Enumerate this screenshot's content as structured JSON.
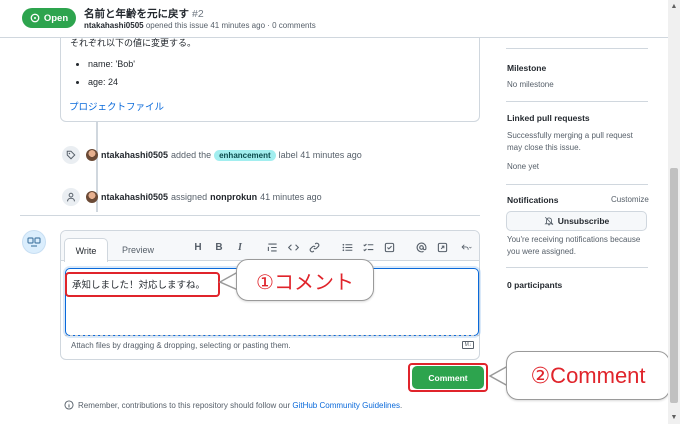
{
  "header": {
    "state": "Open",
    "title": "名前と年齢を元に戻す",
    "number": "#2",
    "author": "ntakahashi0505",
    "meta": "opened this issue 41 minutes ago · 0 comments"
  },
  "body": {
    "cut_text": "それぞれ以下の値に変更する。",
    "bullets": [
      "name: 'Bob'",
      "age: 24"
    ],
    "link": "プロジェクトファイル"
  },
  "timeline": {
    "label_event": {
      "actor": "ntakahashi0505",
      "verb": "added the",
      "label": "enhancement",
      "tail": "label 41 minutes ago"
    },
    "assign_event": {
      "actor": "ntakahashi0505",
      "verb": "assigned",
      "assignee": "nonprokun",
      "tail": "41 minutes ago"
    }
  },
  "editor": {
    "tabs": {
      "write": "Write",
      "preview": "Preview"
    },
    "toolbar": {
      "heading": "H",
      "bold": "B",
      "italic": "I",
      "icons": [
        "quote-icon",
        "code-icon",
        "link-icon",
        "unordered-list-icon",
        "task-list-icon",
        "checkbox-icon",
        "mention-icon",
        "reference-icon",
        "reply-icon"
      ]
    },
    "text": "承知しました！対応しますね。",
    "attach_hint": "Attach files by dragging & dropping, selecting or pasting them.",
    "markdown_badge": "M↓",
    "submit": "Comment"
  },
  "remember": {
    "text": "Remember, contributions to this repository should follow our",
    "link": "GitHub Community Guidelines",
    "tail": "."
  },
  "callouts": {
    "one": "①コメント",
    "two": "②Comment"
  },
  "sidebar": {
    "milestone": {
      "title": "Milestone",
      "value": "No milestone"
    },
    "linked": {
      "title": "Linked pull requests",
      "line1": "Successfully merging a pull request",
      "line2": "may close this issue.",
      "value": "None yet"
    },
    "notifications": {
      "title": "Notifications",
      "customize": "Customize",
      "button": "Unsubscribe",
      "line1": "You're receiving notifications because",
      "line2": "you were assigned."
    },
    "participants": "0 participants"
  },
  "colors": {
    "green": "#2da44e",
    "red_annotation": "#e0242b",
    "link": "#0969da",
    "label_bg": "#a2eeef"
  }
}
